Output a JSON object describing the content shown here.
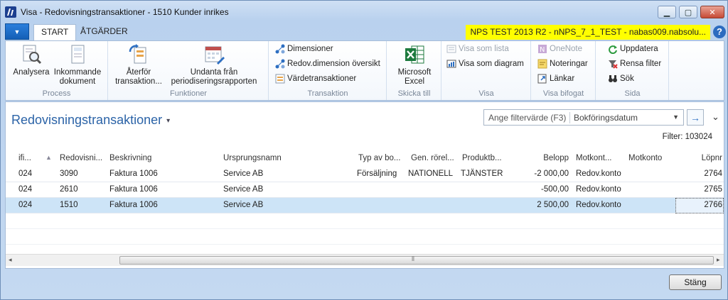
{
  "window": {
    "title": "Visa - Redovisningstransaktioner - 1510 Kunder inrikes",
    "minimize": "▁",
    "maximize": "▢",
    "close": "✕"
  },
  "ribbon_tabs": {
    "file_menu": "▼",
    "tabs": [
      "START",
      "ÅTGÄRDER"
    ],
    "active": "START",
    "server": "NPS TEST 2013 R2 - nNPS_7_1_TEST - nabas009.nabsolu...",
    "help": "?"
  },
  "ribbon": {
    "process": {
      "label": "Process",
      "analyze": "Analysera",
      "incoming_docs_line1": "Inkommande",
      "incoming_docs_line2": "dokument"
    },
    "functions": {
      "label": "Funktioner",
      "reverse_line1": "Återför",
      "reverse_line2": "transaktion...",
      "exclude_line1": "Undanta från",
      "exclude_line2": "periodiseringsrapporten"
    },
    "transaction": {
      "label": "Transaktion",
      "dimensions": "Dimensioner",
      "gl_dimension_overview": "Redov.dimension översikt",
      "value_entries": "Värdetransaktioner"
    },
    "send_to": {
      "label": "Skicka till",
      "excel_line1": "Microsoft",
      "excel_line2": "Excel"
    },
    "view": {
      "label": "Visa",
      "show_as_list": "Visa som lista",
      "show_as_chart": "Visa som diagram"
    },
    "attached": {
      "label": "Visa bifogat",
      "onenote": "OneNote",
      "notes": "Noteringar",
      "links": "Länkar"
    },
    "page": {
      "label": "Sida",
      "refresh": "Uppdatera",
      "clear_filter": "Rensa filter",
      "search": "Sök"
    }
  },
  "page": {
    "title": "Redovisningstransaktioner",
    "title_caret": "▾",
    "filter_placeholder": "Ange filtervärde (F3)",
    "filter_field": "Bokföringsdatum",
    "filter_dropdown": "▼",
    "filter_go": "→",
    "collapse": "⌄",
    "filter_info": "Filter: 103024"
  },
  "grid": {
    "columns": [
      "ifi...",
      "Redovisni...",
      "Beskrivning",
      "Ursprungsnamn",
      "Typ av bo...",
      "Gen. rörel...",
      "Produktb...",
      "Belopp",
      "Motkont...",
      "Motkonto",
      "Löpnr"
    ],
    "sort_indicator": "▲",
    "rows": [
      [
        "024",
        "3090",
        "Faktura 1006",
        "Service AB",
        "Försäljning",
        "NATIONELL",
        "TJÄNSTER",
        "-2 000,00",
        "Redov.konto",
        "",
        "2764"
      ],
      [
        "024",
        "2610",
        "Faktura 1006",
        "Service AB",
        "",
        "",
        "",
        "-500,00",
        "Redov.konto",
        "",
        "2765"
      ],
      [
        "024",
        "1510",
        "Faktura 1006",
        "Service AB",
        "",
        "",
        "",
        "2 500,00",
        "Redov.konto",
        "",
        "2766"
      ]
    ],
    "selected_row": 2
  },
  "scrollbar": {
    "left_arrow": "◂",
    "right_arrow": "▸",
    "grip": "⦀"
  },
  "footer": {
    "close_button": "Stäng"
  }
}
